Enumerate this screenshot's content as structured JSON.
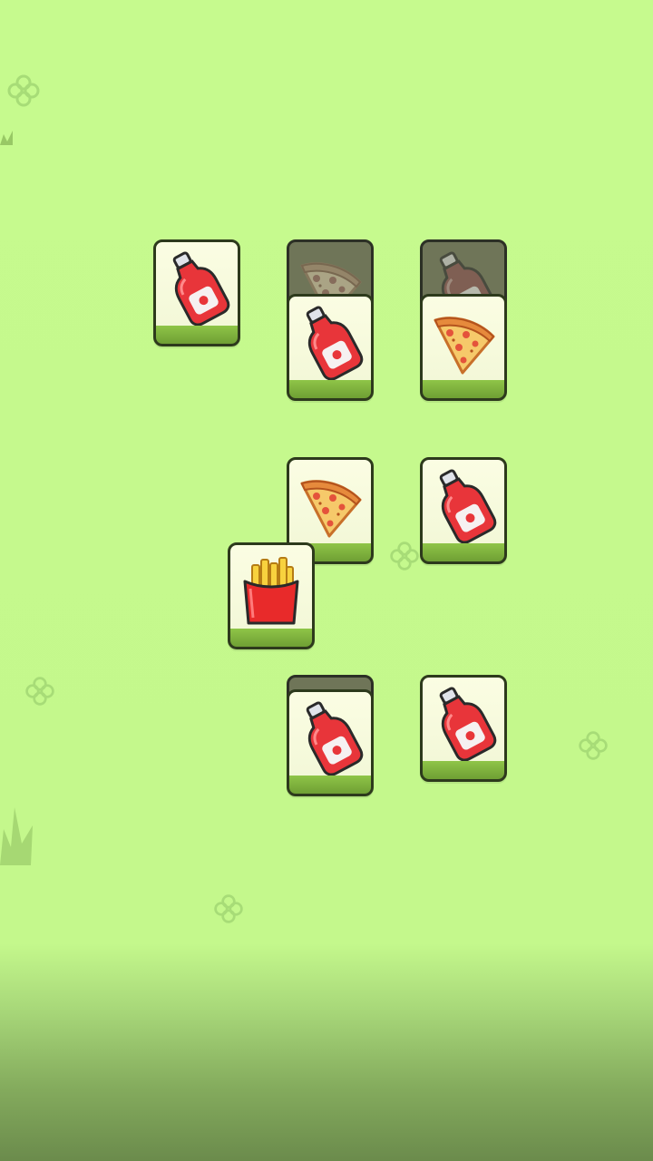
{
  "colors": {
    "background": "#c6fa8e",
    "tile_face": "#f6f9dc",
    "tile_base": "#7fb23d",
    "tile_border": "#2d3a1c",
    "covered_tile": "#6f7558"
  },
  "tiles": [
    {
      "item": "ketchup",
      "state": "free"
    },
    {
      "item": "pizza",
      "state": "covered"
    },
    {
      "item": "ketchup",
      "state": "free"
    },
    {
      "item": "ketchup",
      "state": "covered"
    },
    {
      "item": "pizza",
      "state": "free"
    },
    {
      "item": "pizza",
      "state": "free"
    },
    {
      "item": "ketchup",
      "state": "free"
    },
    {
      "item": "fries",
      "state": "free"
    },
    {
      "item": "blank",
      "state": "covered"
    },
    {
      "item": "ketchup",
      "state": "free"
    },
    {
      "item": "ketchup",
      "state": "free"
    }
  ]
}
